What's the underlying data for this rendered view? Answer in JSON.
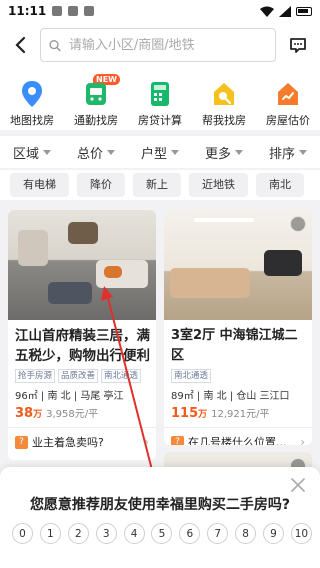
{
  "status_bar": {
    "time": "11:11"
  },
  "search": {
    "placeholder": "请输入小区/商圈/地铁"
  },
  "quick_actions": [
    {
      "label": "地图找房",
      "icon": "map-pin-icon",
      "color": "#3a8dff"
    },
    {
      "label": "通勤找房",
      "icon": "commute-icon",
      "color": "#1fb86b",
      "badge": "NEW"
    },
    {
      "label": "房贷计算",
      "icon": "calculator-icon",
      "color": "#16b86c"
    },
    {
      "label": "帮我找房",
      "icon": "house-search-icon",
      "color": "#f5c11c"
    },
    {
      "label": "房屋估价",
      "icon": "house-value-icon",
      "color": "#f57c2c"
    }
  ],
  "filters": [
    "区域",
    "总价",
    "户型",
    "更多",
    "排序"
  ],
  "tags": [
    "有电梯",
    "降价",
    "新上",
    "近地铁",
    "南北"
  ],
  "listings": [
    {
      "title": "江山首府精装三居，满五税少，购物出行便利",
      "chips": [
        "抢手房源",
        "品质改善",
        "南北通透"
      ],
      "meta": "96㎡ | 南 北 | 马尾 亭江",
      "price": "38",
      "price_unit": "万",
      "unit_price": "3,958元/平",
      "ask": "业主着急卖吗?"
    },
    {
      "title": "3室2厅 中海锦江城二区",
      "chips": [
        "南北通透"
      ],
      "meta": "89㎡ | 南 北 | 仓山 三江口",
      "price": "115",
      "price_unit": "万",
      "unit_price": "12,921元/平",
      "ask": "在几号楼什么位置..."
    }
  ],
  "survey": {
    "question": "您愿意推荐朋友使用幸福里购买二手房吗?",
    "scale": [
      "0",
      "1",
      "2",
      "3",
      "4",
      "5",
      "6",
      "7",
      "8",
      "9",
      "10"
    ]
  },
  "colors": {
    "accent": "#f25a1d",
    "annotation_arrow": "#e0302e"
  }
}
